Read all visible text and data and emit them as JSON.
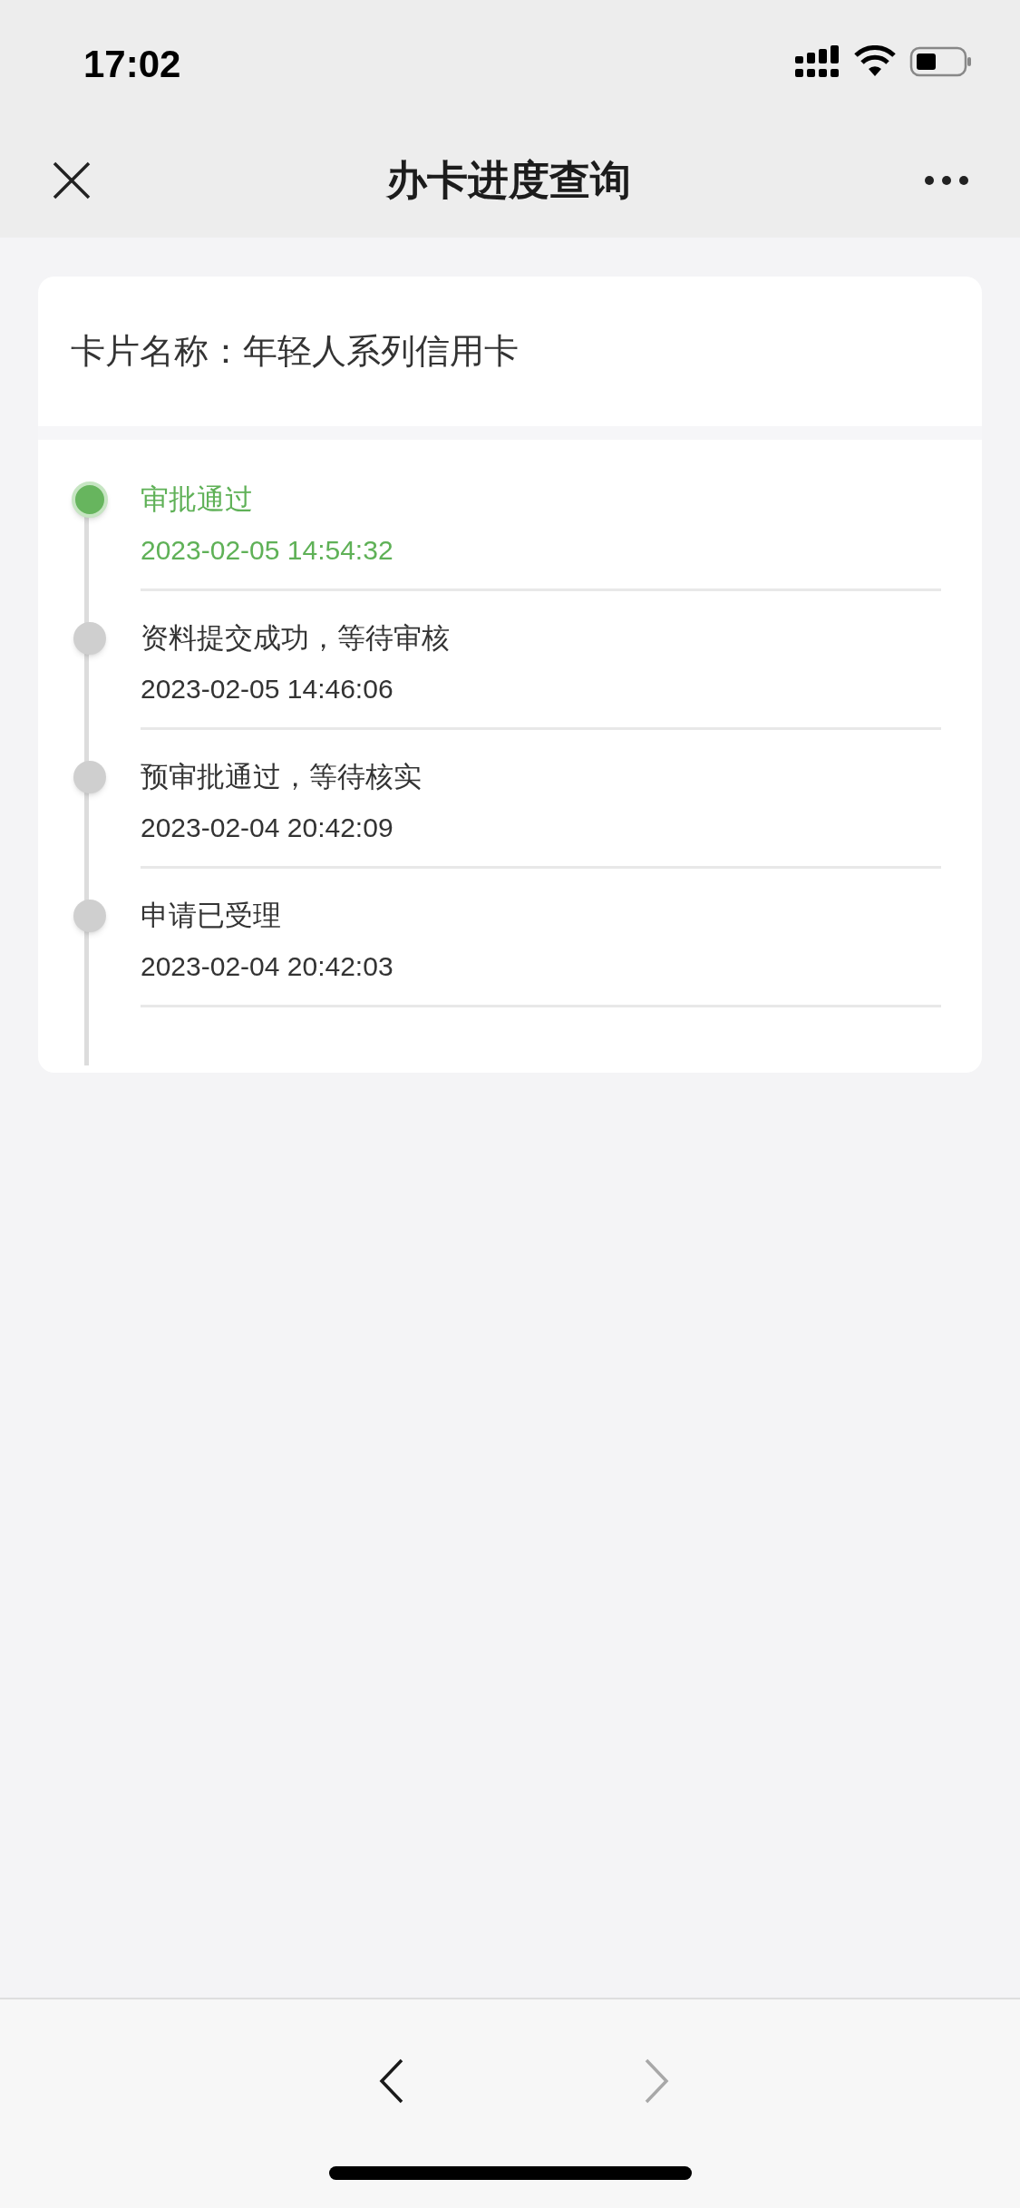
{
  "status_bar": {
    "time": "17:02"
  },
  "nav_bar": {
    "title": "办卡进度查询"
  },
  "card": {
    "name": "卡片名称：年轻人系列信用卡"
  },
  "timeline": [
    {
      "title": "审批通过",
      "time": "2023-02-05 14:54:32",
      "active": true
    },
    {
      "title": "资料提交成功，等待审核",
      "time": "2023-02-05 14:46:06",
      "active": false
    },
    {
      "title": "预审批通过，等待核实",
      "time": "2023-02-04 20:42:09",
      "active": false
    },
    {
      "title": "申请已受理",
      "time": "2023-02-04 20:42:03",
      "active": false
    }
  ],
  "toolbar": {
    "back": {
      "disabled": false
    },
    "forward": {
      "disabled": true
    }
  }
}
